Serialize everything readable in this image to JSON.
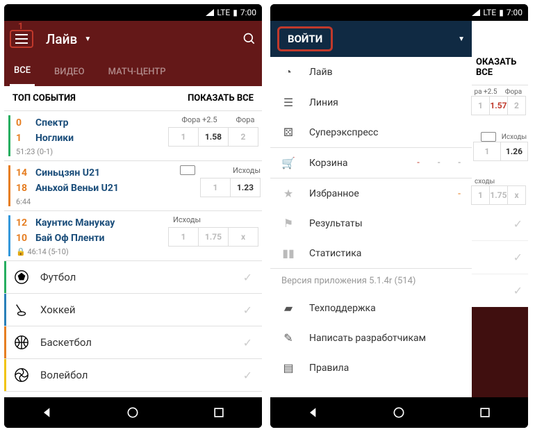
{
  "status": {
    "lte": "LTE",
    "time": "7:00"
  },
  "left": {
    "menu_badge": "1",
    "title": "Лайв",
    "tabs": [
      "ВСЕ",
      "ВИДЕО",
      "МАТЧ-ЦЕНТР"
    ],
    "section": {
      "title": "ТОП СОБЫТИЯ",
      "action": "ПОКАЗАТЬ ВСЕ"
    },
    "matches": [
      {
        "s1": "0",
        "t1": "Спектр",
        "s2": "1",
        "t2": "Ноглики",
        "time": "51:23 (0-1)",
        "hdr": [
          "Фора +2.5",
          "Фора"
        ],
        "odds": [
          "1",
          "1.58",
          "2"
        ]
      },
      {
        "s1": "14",
        "t1": "Синьцзян U21",
        "s2": "18",
        "t2": "Аньхой Веньи U21",
        "time": "6:44",
        "hdr": [
          "Исходы"
        ],
        "odds": [
          "1",
          "1.23"
        ],
        "tv": true
      },
      {
        "s1": "12",
        "t1": "Каунтис Манукау",
        "s2": "10",
        "t2": "Бай Оф Пленти",
        "time": "46:14 (5-10)",
        "lock": true,
        "hdr": [
          "Исходы"
        ],
        "odds": [
          "1",
          "1.75",
          "x"
        ]
      }
    ],
    "sports": [
      {
        "name": "Футбол",
        "color": "#27ae60"
      },
      {
        "name": "Хоккей",
        "color": "#2980b9"
      },
      {
        "name": "Баскетбол",
        "color": "#e67e22"
      },
      {
        "name": "Волейбол",
        "color": "#f1c40f"
      }
    ]
  },
  "right": {
    "login": "ВОЙТИ",
    "items_top": [
      {
        "icon": "◔",
        "label": "Лайв"
      },
      {
        "icon": "☰",
        "label": "Линия"
      },
      {
        "icon": "⚄",
        "label": "Суперэкспресс"
      }
    ],
    "cart": {
      "icon": "🛒",
      "label": "Корзина",
      "vals": [
        "-",
        "-",
        "-"
      ]
    },
    "items_mid": [
      {
        "icon": "★",
        "label": "Избранное",
        "badge": "-"
      },
      {
        "icon": "⚑",
        "label": "Результаты"
      },
      {
        "icon": "▮▮",
        "label": "Статистика"
      }
    ],
    "version": "Версия приложения 5.1.4r (514)",
    "items_bot": [
      {
        "icon": "▰",
        "label": "Техподдержка"
      },
      {
        "icon": "✎",
        "label": "Написать разработчикам"
      },
      {
        "icon": "▤",
        "label": "Правила"
      }
    ],
    "peek_section": "ОКАЗАТЬ ВСЕ",
    "peek": [
      {
        "hdr": [
          "ра +2.5",
          "Фора"
        ],
        "odds": [
          "1",
          "1.57",
          "2"
        ]
      },
      {
        "hdr": [
          "Исходы"
        ],
        "odds": [
          "1",
          "1.26"
        ],
        "tv": true
      },
      {
        "hdr": [
          "сходы"
        ],
        "odds": [
          "1",
          "1.75",
          "x"
        ]
      }
    ]
  }
}
